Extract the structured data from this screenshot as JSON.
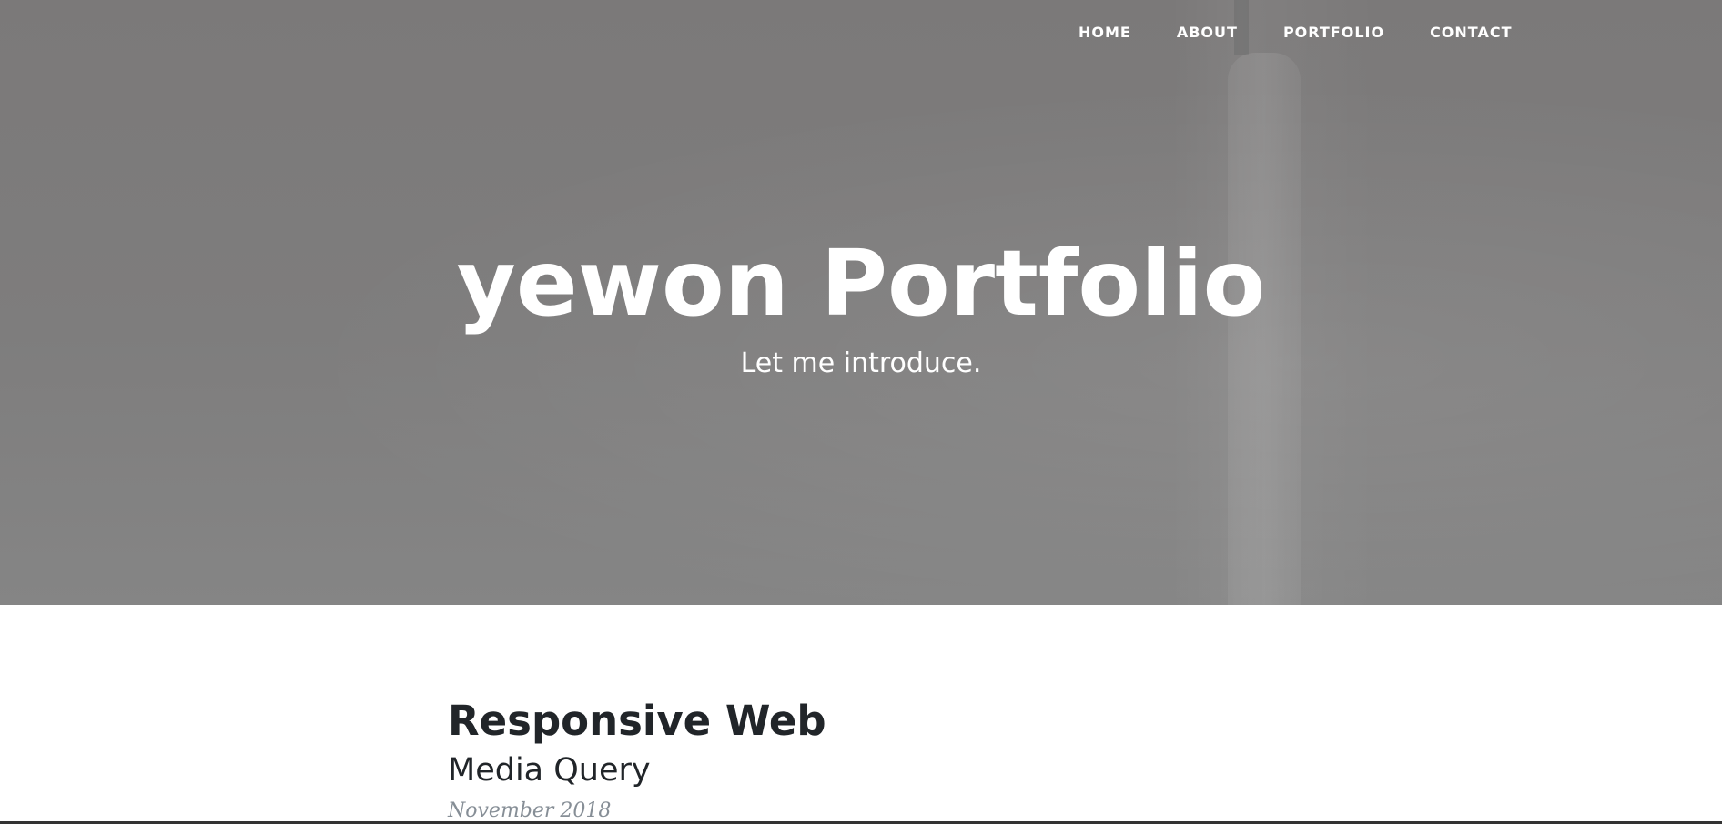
{
  "nav": {
    "items": [
      {
        "label": "HOME"
      },
      {
        "label": "ABOUT"
      },
      {
        "label": "PORTFOLIO"
      },
      {
        "label": "CONTACT"
      }
    ]
  },
  "hero": {
    "title": "yewon Portfolio",
    "subtitle": "Let me introduce."
  },
  "post": {
    "title": "Responsive Web",
    "subtitle": "Media Query",
    "meta": "November 2018"
  },
  "colors": {
    "hero_overlay": "#7e7d7d",
    "heading_text": "#212529",
    "meta_text": "#868e96",
    "nav_text": "#ffffff"
  }
}
